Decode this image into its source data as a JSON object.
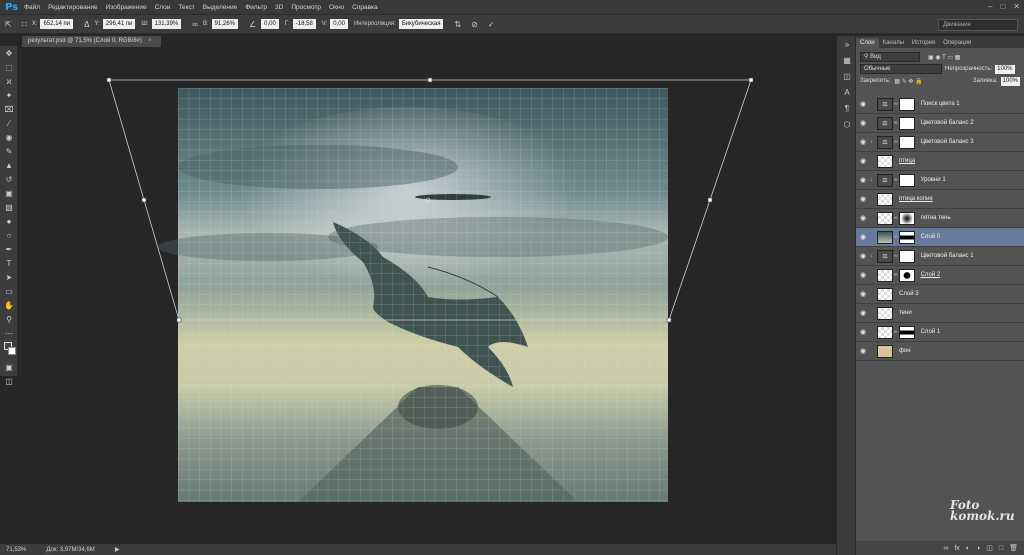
{
  "menubar": {
    "logo": "Ps",
    "items": [
      "Файл",
      "Редактирование",
      "Изображение",
      "Слои",
      "Текст",
      "Выделение",
      "Фильтр",
      "3D",
      "Просмотр",
      "Окно",
      "Справка"
    ]
  },
  "options": {
    "x_label": "X:",
    "x_value": "652,14 пи",
    "y_label": "Y:",
    "y_value": "296,41 пи",
    "w_label": "Ш:",
    "w_value": "131,39%",
    "h_label": "В:",
    "h_value": "91,26%",
    "angle_value": "0,00",
    "hskew_label": "Г:",
    "hskew_value": "-18,58",
    "vskew_label": "V:",
    "vskew_value": "0,00",
    "interp_label": "Интерполяция:",
    "interp_value": "Бикубическая",
    "workspace": "Движение"
  },
  "document": {
    "tab_title": "результат.psd @ 71,5% (Слой 0, RGB/8#)",
    "zoom": "71,53%",
    "doc_info": "Док: 3,97M/34,6M"
  },
  "layers_panel": {
    "tabs": [
      "Слои",
      "Каналы",
      "История",
      "Операции"
    ],
    "filter_label": "Вид",
    "blend_mode": "Обычные",
    "opacity_label": "Непрозрачность:",
    "opacity_value": "100%",
    "lock_label": "Закрепить:",
    "fill_label": "Заливка:",
    "fill_value": "100%",
    "layers": [
      {
        "name": "Поиск цвета 1",
        "kind": "adjust",
        "mask": "white"
      },
      {
        "name": "Цветовой баланс 2",
        "kind": "adjust",
        "mask": "white"
      },
      {
        "name": "Цветовой баланс 3",
        "kind": "adjust",
        "mask": "white",
        "clipped": true
      },
      {
        "name": "птица",
        "kind": "bird",
        "mask": "",
        "underline": true
      },
      {
        "name": "Уровни 1",
        "kind": "adjust",
        "mask": "white",
        "clipped": true
      },
      {
        "name": "птица копия",
        "kind": "checker",
        "mask": "",
        "underline": true
      },
      {
        "name": "пятна тень",
        "kind": "checker",
        "mask": "blur-spot"
      },
      {
        "name": "Слой 0",
        "kind": "sky",
        "mask": "black-band",
        "selected": true
      },
      {
        "name": "Цветовой баланс 1",
        "kind": "adjust",
        "mask": "white",
        "clipped": true
      },
      {
        "name": "Слой 2",
        "kind": "checker",
        "mask": "dark-spot",
        "underline": true
      },
      {
        "name": "Слой 3",
        "kind": "checker",
        "mask": ""
      },
      {
        "name": "тени",
        "kind": "checker",
        "mask": ""
      },
      {
        "name": "Слой 1",
        "kind": "checker",
        "mask": "black-band"
      },
      {
        "name": "фон",
        "kind": "beige",
        "mask": ""
      }
    ]
  },
  "watermark": {
    "line1": "Foto",
    "line2": "komok.ru"
  }
}
